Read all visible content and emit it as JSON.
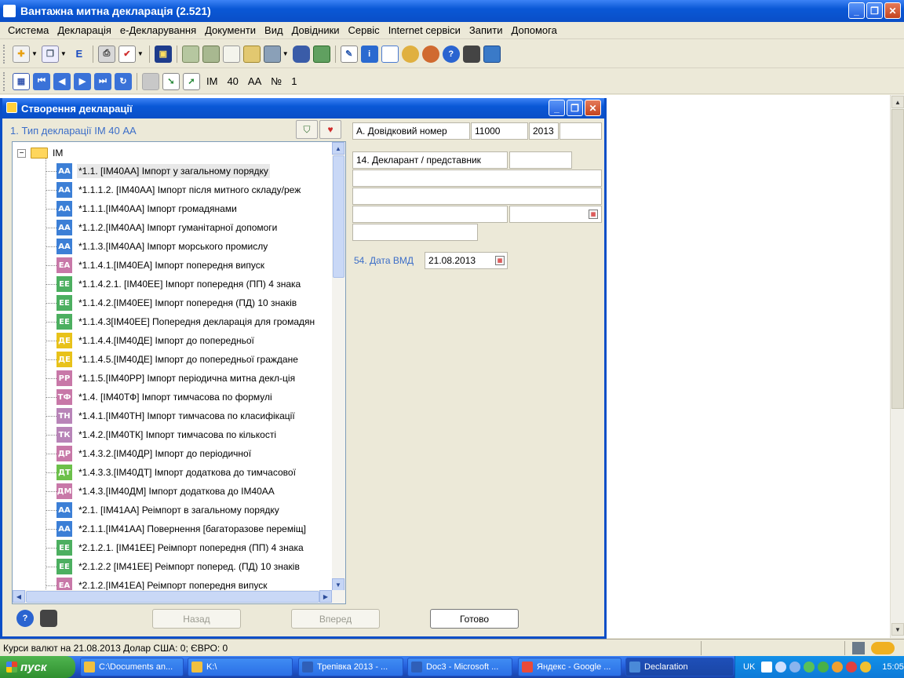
{
  "app": {
    "title": "Вантажна митна декларація (2.521)",
    "window_buttons": {
      "minimize": "_",
      "restore": "❐",
      "close": "✕"
    }
  },
  "menu": [
    "Система",
    "Декларація",
    "е-Декларування",
    "Документи",
    "Вид",
    "Довідники",
    "Сервіс",
    "Internet сервіси",
    "Запити",
    "Допомога"
  ],
  "toolbar2": {
    "type_code": "ІМ",
    "regime_code": "40",
    "subtype_code": "АА",
    "number_label": "№",
    "number_value": "1"
  },
  "dialog": {
    "title": "Створення декларації",
    "decl_type_label": "1. Тип декларації   ІМ  40  АА",
    "tree": {
      "root": "ІМ",
      "expander": "−",
      "items": [
        {
          "code": "АА",
          "color": "#3c7fd6",
          "label": "*1.1.   [ІМ40АА] Імпорт у загальному порядку",
          "selected": true
        },
        {
          "code": "АА",
          "color": "#3c7fd6",
          "label": "*1.1.1.2. [ІМ40АА] Імпорт після митного складу/реж"
        },
        {
          "code": "АА",
          "color": "#3c7fd6",
          "label": "*1.1.1.[ІМ40АА] Імпорт громадянами"
        },
        {
          "code": "АА",
          "color": "#3c7fd6",
          "label": "*1.1.2.[ІМ40АА] Імпорт гуманітарної допомоги"
        },
        {
          "code": "АА",
          "color": "#3c7fd6",
          "label": "*1.1.3.[ІМ40АА] Імпорт морського промислу"
        },
        {
          "code": "ЕА",
          "color": "#c878a8",
          "label": "*1.1.4.1.[ІМ40ЕА] Імпорт попередня випуск"
        },
        {
          "code": "ЕЕ",
          "color": "#4caf60",
          "label": "*1.1.4.2.1. [ІМ40ЕЕ] Імпорт попередня (ПП) 4 знака"
        },
        {
          "code": "ЕЕ",
          "color": "#4caf60",
          "label": "*1.1.4.2.[ІМ40ЕЕ] Імпорт попередня (ПД) 10 знаків"
        },
        {
          "code": "ЕЕ",
          "color": "#4caf60",
          "label": "*1.1.4.3[ІМ40ЕЕ] Попередня декларація для громадян"
        },
        {
          "code": "ДЕ",
          "color": "#e8c21a",
          "label": "*1.1.4.4.[ІМ40ДЕ] Імпорт до попередньої"
        },
        {
          "code": "ДЕ",
          "color": "#e8c21a",
          "label": "*1.1.4.5.[ІМ40ДЕ] Імпорт до попередньої граждане"
        },
        {
          "code": "РР",
          "color": "#c878a8",
          "label": "*1.1.5.[ІМ40РР] Імпорт періодична митна декл-ція"
        },
        {
          "code": "ТФ",
          "color": "#c878a8",
          "label": "*1.4. [ІМ40ТФ] Імпорт тимчасова по формулі"
        },
        {
          "code": "ТН",
          "color": "#b884b8",
          "label": "*1.4.1.[ІМ40ТН] Імпорт тимчасова по класифікації"
        },
        {
          "code": "ТК",
          "color": "#b884b8",
          "label": "*1.4.2.[ІМ40ТК] Імпорт тимчасова по кількості"
        },
        {
          "code": "ДР",
          "color": "#c878a8",
          "label": "*1.4.3.2.[ІМ40ДР] Імпорт до періодичної"
        },
        {
          "code": "ДТ",
          "color": "#6cc04a",
          "label": "*1.4.3.3.[ІМ40ДТ] Імпорт додаткова до тимчасової"
        },
        {
          "code": "ДМ",
          "color": "#c878a8",
          "label": "*1.4.3.[ІМ40ДМ] Імпорт додаткова до ІМ40АА"
        },
        {
          "code": "АА",
          "color": "#3c7fd6",
          "label": "*2.1.   [ІМ41АА] Реімпорт в загальному порядку"
        },
        {
          "code": "АА",
          "color": "#3c7fd6",
          "label": "*2.1.1.[ІМ41АА] Повернення  [багаторазове переміщ]"
        },
        {
          "code": "ЕЕ",
          "color": "#4caf60",
          "label": "*2.1.2.1. [ІМ41ЕЕ] Реімпорт попередня (ПП) 4 знака"
        },
        {
          "code": "ЕЕ",
          "color": "#4caf60",
          "label": "*2.1.2.2 [ІМ41ЕЕ] Реімпорт поперед. (ПД) 10 знаків"
        },
        {
          "code": "ЕА",
          "color": "#c878a8",
          "label": "*2.1.2.[ІМ41ЕА] Реімпорт попередня випуск"
        }
      ]
    },
    "form": {
      "ref_label": "А. Довідковий номер",
      "ref_customs": "11000",
      "ref_year": "2013",
      "ref_extra": "",
      "declarant_label": "14. Декларант / представник",
      "date_label": "54. Дата ВМД",
      "date_value": "21.08.2013"
    },
    "buttons": {
      "back": "Назад",
      "forward": "Вперед",
      "done": "Готово"
    }
  },
  "status": {
    "text": "Курси валют на 21.08.2013  Долар США: 0; ЄВРО: 0"
  },
  "taskbar": {
    "start": "пуск",
    "tasks": [
      {
        "label": "C:\\Documents an...",
        "icon_color": "#f0c040"
      },
      {
        "label": "K:\\",
        "icon_color": "#f0c040"
      },
      {
        "label": "Трепівка 2013 - ...",
        "icon_color": "#2f5fb8"
      },
      {
        "label": "Doc3 - Microsoft ...",
        "icon_color": "#2f5fb8"
      },
      {
        "label": "Яндекс - Google ...",
        "icon_color": "#e84a3a"
      },
      {
        "label": "Declaration",
        "icon_color": "#4a8ad8",
        "active": true
      }
    ],
    "lang": "UK",
    "clock": "15:05"
  }
}
